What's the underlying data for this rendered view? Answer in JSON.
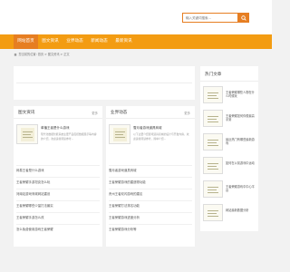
{
  "header": {
    "search": {
      "placeholder": "输入关键词搜索..."
    }
  },
  "nav": {
    "items": [
      {
        "label": "网站首页",
        "active": true
      },
      {
        "label": "图文资讯",
        "active": false
      },
      {
        "label": "业界动态",
        "active": false
      },
      {
        "label": "新闻动态",
        "active": false
      },
      {
        "label": "最新资讯",
        "active": false
      }
    ]
  },
  "breadcrumb": {
    "text": "您当前的位置: 首页 > 图文资讯 > 正文",
    "home_icon": "home-icon"
  },
  "panel_left": {
    "title": "图文资讯",
    "more": "更多",
    "feature": {
      "title": "单播王者是什么游戏",
      "desc": "现代化数据智能系统主要产品包括数据展示等内容的介绍，欢迎读者阅读参考..."
    },
    "list": [
      "网易王者是什么游戏",
      "王者荣耀手游坦克怎么玩",
      "河南站游戏商城网站建设",
      "王者荣耀哪些少量打法最实",
      "王者荣耀手游怎么改",
      "怎么免费使用游戏王者荣耀"
    ]
  },
  "panel_mid": {
    "title": "业界动态",
    "more": "更多",
    "feature": {
      "title": "雪月者游戏道具商城",
      "desc": "以下主要介绍游戏道具商城的设计与开发内容，欢迎读者阅读参考，简单介绍..."
    },
    "list": [
      "雪月者游戏道具商城",
      "王者荣耀游戏的建造物功能",
      "贵州王者双闪游戏的建议",
      "王者荣耀打法排名功能",
      "王者荣耀游戏进度分析",
      "王者荣耀游戏分析等"
    ]
  },
  "sidebar": {
    "title": "热门文章",
    "items": [
      {
        "text": "王者荣耀哪些人物在什么时候玩"
      },
      {
        "text": "王者荣耀如何你想最高手到"
      },
      {
        "text": "最近热门有哪些最新游戏"
      },
      {
        "text": "如何在以前游戏中运动"
      },
      {
        "text": "王者荣耀游戏中中心平台"
      },
      {
        "text": "网站最新数据分析"
      }
    ]
  },
  "colors": {
    "accent": "#f39c12",
    "accent_dark": "#e67e22",
    "background": "#f2f2f2"
  }
}
